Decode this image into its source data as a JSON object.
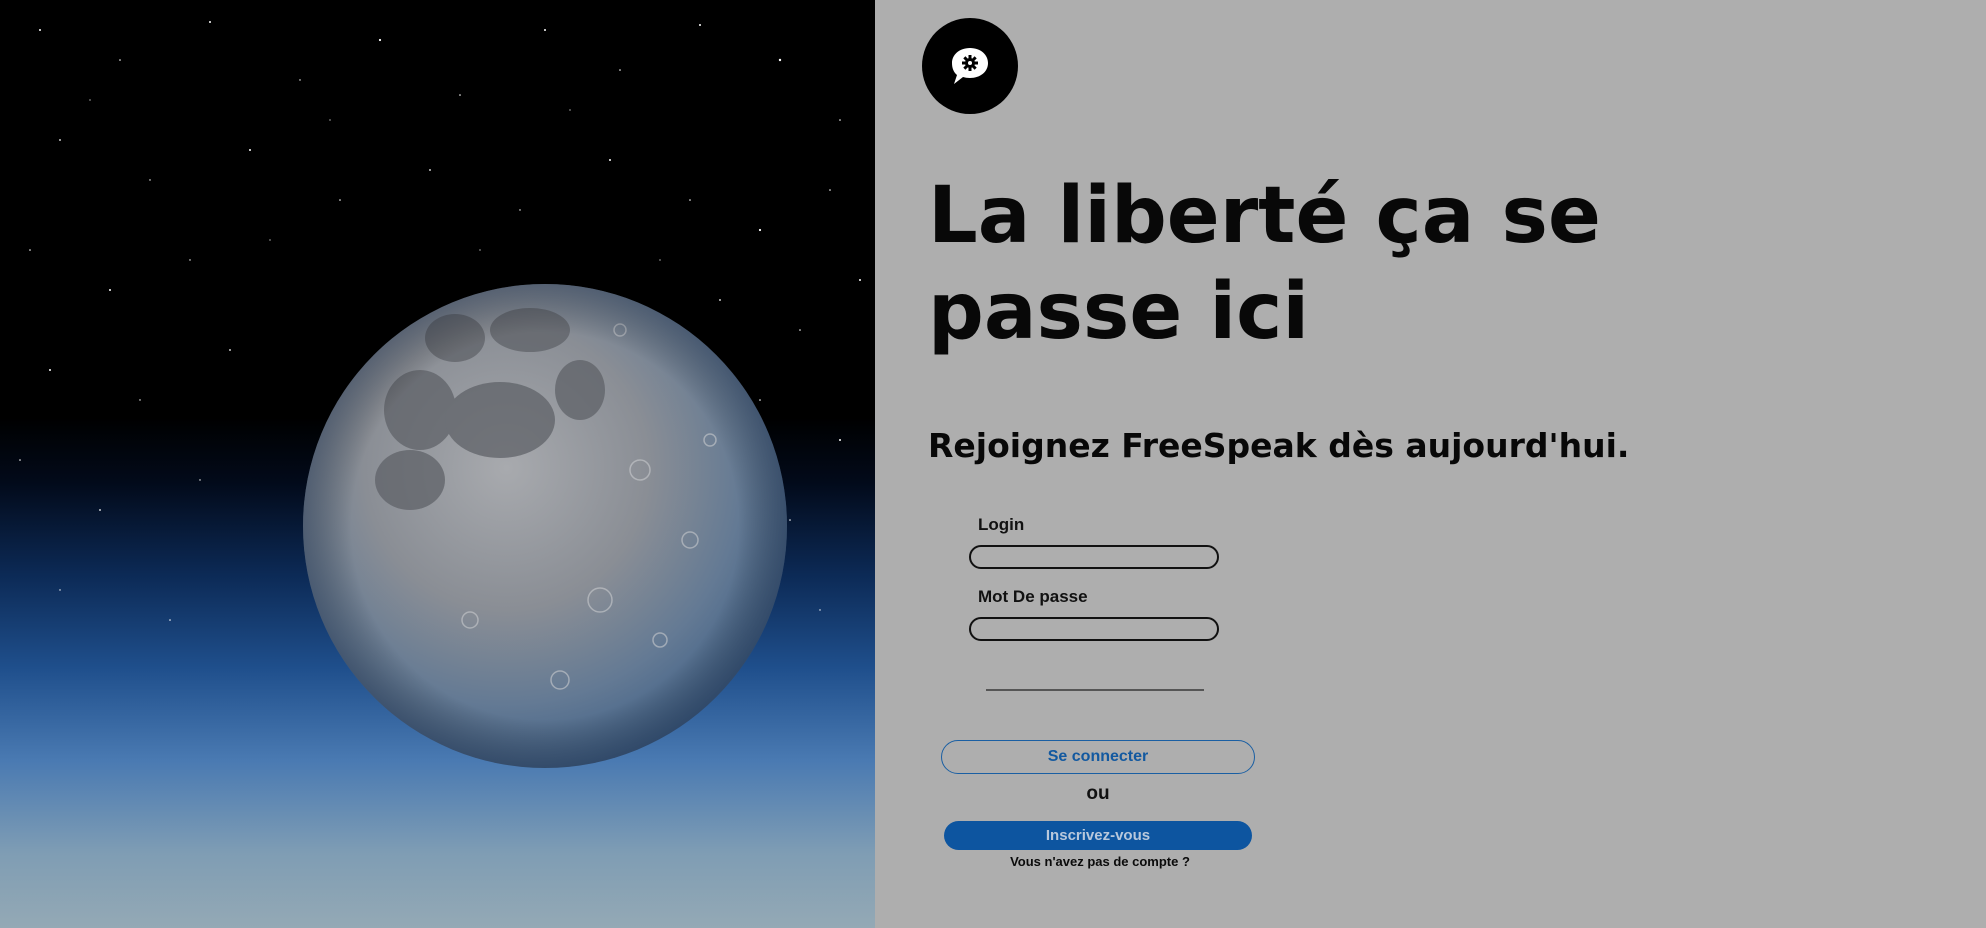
{
  "brand": {
    "logo_icon": "speech-bubble-gear-icon",
    "panel_background": "#aeaeae",
    "accent": "#0d55a0"
  },
  "hero": {
    "image": "moon-over-blue-horizon"
  },
  "headline": "La liberté ça se passe ici",
  "subheadline": "Rejoignez FreeSpeak dès aujourd'hui.",
  "login_form": {
    "login_label": "Login",
    "login_value": "",
    "password_label": "Mot De passe",
    "password_value": "",
    "connect_button": "Se connecter",
    "or_text": "ou",
    "signup_button": "Inscrivez-vous",
    "no_account_text": "Vous n'avez pas de compte ?"
  }
}
